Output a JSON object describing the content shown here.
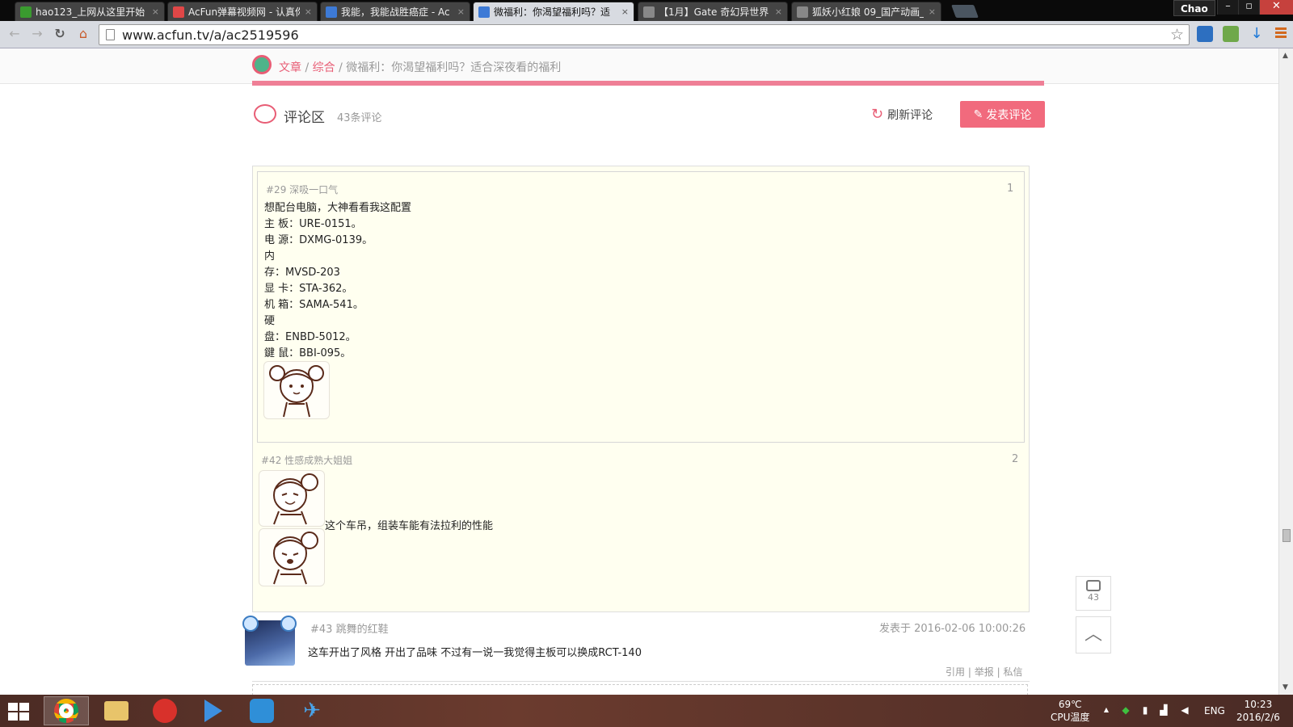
{
  "browser": {
    "tabs": [
      {
        "title": "hao123_上网从这里开始",
        "favicon_color": "#3a9a2f",
        "active": false
      },
      {
        "title": "AcFun弹幕视频网 - 认真你",
        "favicon_color": "#e04747",
        "active": false
      },
      {
        "title": "我能，我能战胜癌症 - Ac",
        "favicon_color": "#3d7ad6",
        "active": false
      },
      {
        "title": "微福利：你渴望福利吗？适",
        "favicon_color": "#3d7ad6",
        "active": true
      },
      {
        "title": "【1月】Gate 奇幻异世界",
        "favicon_color": "#888888",
        "active": false
      },
      {
        "title": "狐妖小红娘 09_国产动画_",
        "favicon_color": "#888888",
        "active": false
      }
    ],
    "close_glyph": "×",
    "user": "Chao",
    "window_buttons": {
      "minimize": "–",
      "maximize": "▫",
      "close": "✕"
    },
    "url": "www.acfun.tv/a/ac2519596",
    "star_icon": "☆",
    "nav_icons": {
      "back": "←",
      "forward": "→",
      "reload": "↻",
      "home": "⌂"
    }
  },
  "breadcrumb": {
    "first": "文章",
    "sep": "/",
    "second": "综合",
    "title": "微福利：你渴望福利吗？适合深夜看的福利"
  },
  "comments_header": {
    "title": "评论区",
    "count": "43条评论",
    "refresh": "刷新评论",
    "post": "发表评论"
  },
  "comment": {
    "quotes": [
      {
        "floor": "#29",
        "user": "深吸一口气",
        "index": "1",
        "lines": [
          "想配台电脑，大神看看我这配置",
          "主 板：URE-0151。",
          "电 源：DXMG-0139。",
          "内",
          "存：MVSD-203",
          "显 卡：STA-362。",
          "机 箱：SAMA-541。",
          "硬",
          "盘：ENBD-5012。",
          "鍵 鼠：BBI-095。"
        ]
      },
      {
        "floor": "#42",
        "user": "性感成熟大姐姐",
        "index": "2",
        "text": "这个车吊，组装车能有法拉利的性能"
      }
    ],
    "floor": "#43",
    "user": "跳舞的红鞋",
    "date": "发表于 2016-02-06 10:00:26",
    "text": "这车开出了风格 开出了品味 不过有一说一我觉得主板可以换成RCT-140",
    "actions": {
      "quote": "引用",
      "report": "举报",
      "message": "私信",
      "sep": "|"
    }
  },
  "side_buttons": {
    "comments_count": "43",
    "to_top": "︿"
  },
  "taskbar": {
    "temp": "69℃",
    "temp_label": "CPU温度",
    "tray_arrow": "▲",
    "lang": "ENG",
    "time": "10:23",
    "date": "2016/2/6"
  },
  "colors": {
    "accent": "#e85d75",
    "button": "#f16a7d",
    "comment_bg": "#fffff0"
  }
}
